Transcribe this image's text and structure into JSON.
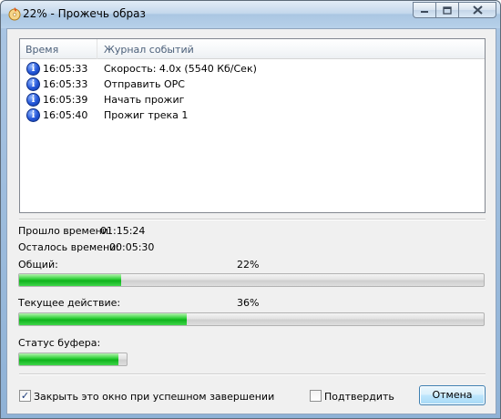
{
  "window": {
    "title": "22% - Прожечь образ"
  },
  "log": {
    "columns": {
      "time": "Время",
      "event": "Журнал событий"
    },
    "rows": [
      {
        "time": "16:05:33",
        "text": "Скорость: 4.0x (5540 Кб/Сек)",
        "icon": "info-icon"
      },
      {
        "time": "16:05:33",
        "text": "Отправить OPC",
        "icon": "info-icon"
      },
      {
        "time": "16:05:39",
        "text": "Начать прожиг",
        "icon": "info-icon"
      },
      {
        "time": "16:05:40",
        "text": "Прожиг трека 1",
        "icon": "info-icon"
      }
    ]
  },
  "stats": {
    "elapsed_label": "Прошло времени:",
    "elapsed_value": "01:15:24",
    "remaining_label": "Осталось времени:",
    "remaining_value": "00:05:30"
  },
  "progress": {
    "total_label": "Общий:",
    "total_percent_text": "22%",
    "total_fraction": 0.22,
    "current_label": "Текущее действие:",
    "current_percent_text": "36%",
    "current_fraction": 0.36,
    "buffer_label": "Статус буфера:",
    "buffer_fraction": 0.92,
    "fill_color": "#1cc028"
  },
  "footer": {
    "close_when_done_label": "Закрыть это окно при успешном завершении",
    "close_when_done_checked": "✓",
    "verify_label": "Подтвердить",
    "verify_checked": "",
    "cancel_label": "Отмена"
  }
}
